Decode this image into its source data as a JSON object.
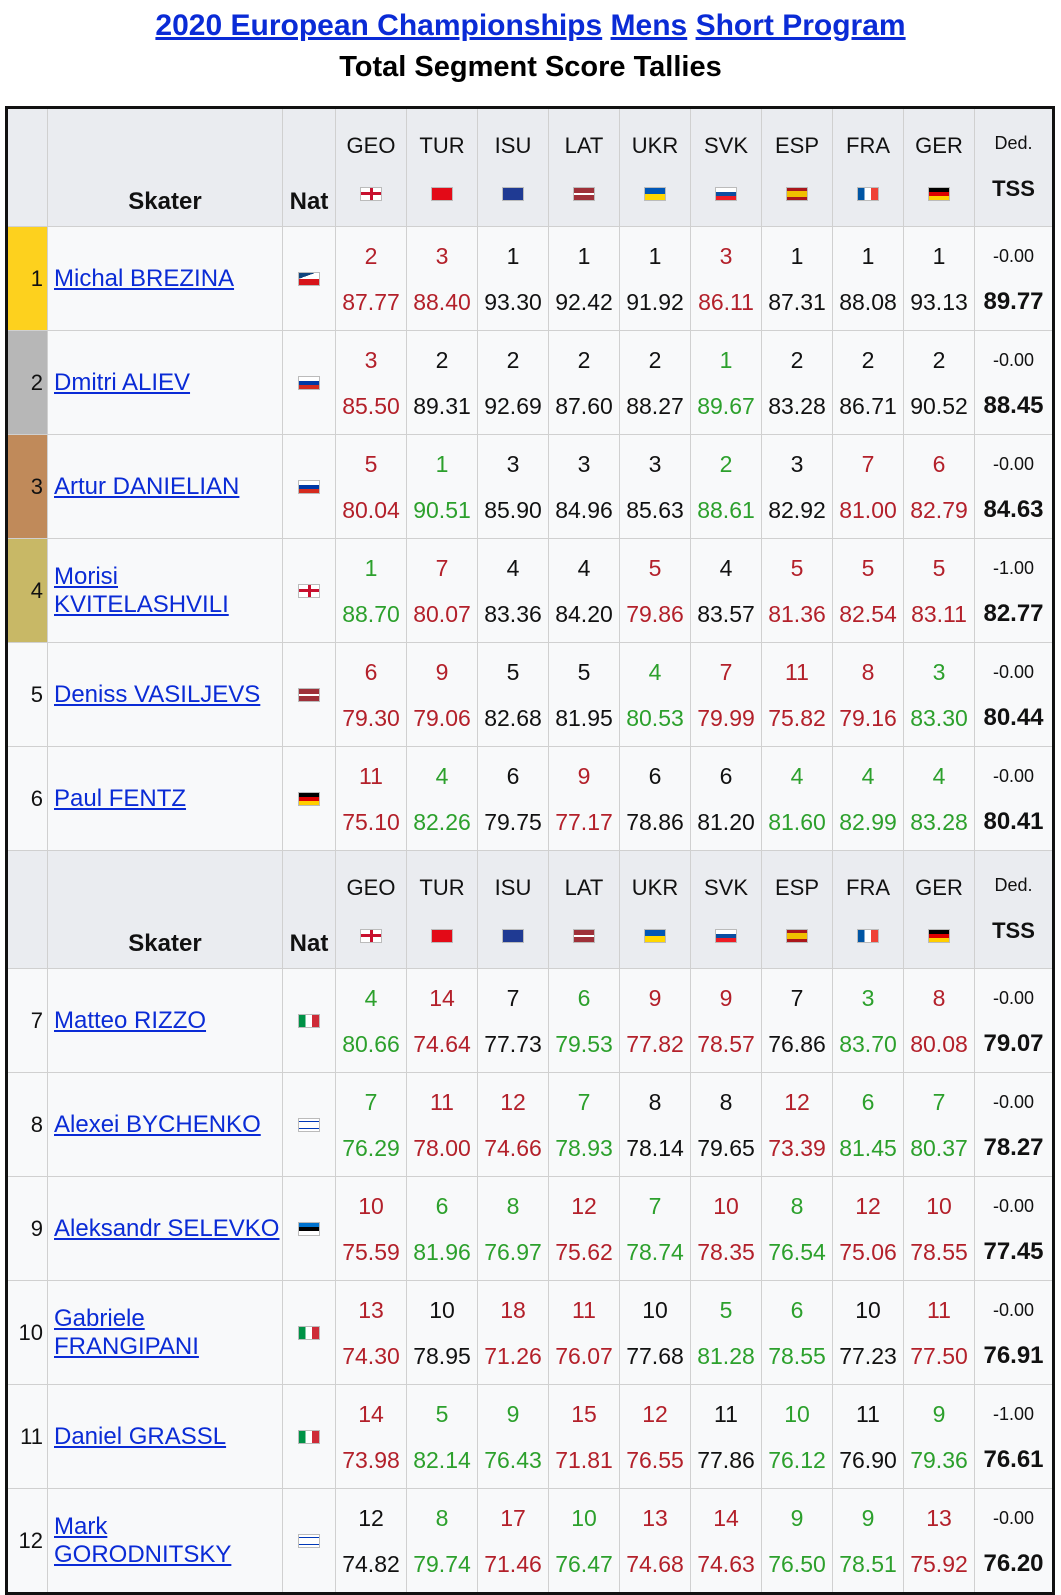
{
  "title": {
    "link1": "2020 European Championships",
    "link2": "Mens",
    "link3": "Short Program"
  },
  "subtitle": "Total Segment Score Tallies",
  "header": {
    "skater": "Skater",
    "nat": "Nat",
    "ded": "Ded.",
    "tss": "TSS",
    "judges": [
      "GEO",
      "TUR",
      "ISU",
      "LAT",
      "UKR",
      "SVK",
      "ESP",
      "FRA",
      "GER"
    ]
  },
  "colors": {
    "gold": "#fdd11e",
    "silver": "#b7b7b7",
    "bronze": "#c08a5a",
    "fourth": "#c8b866",
    "green": "#2ca02c",
    "red": "#b3202a",
    "link": "#0a2bd6"
  },
  "rows": [
    {
      "rank": "1",
      "name": "Michal BREZINA",
      "nat_flag": "CZE",
      "ded": "-0.00",
      "tss": "89.77",
      "cells": [
        [
          "2",
          "87.77",
          "red"
        ],
        [
          "3",
          "88.40",
          "red"
        ],
        [
          "1",
          "93.30",
          "black"
        ],
        [
          "1",
          "92.42",
          "black"
        ],
        [
          "1",
          "91.92",
          "black"
        ],
        [
          "3",
          "86.11",
          "red"
        ],
        [
          "1",
          "87.31",
          "black"
        ],
        [
          "1",
          "88.08",
          "black"
        ],
        [
          "1",
          "93.13",
          "black"
        ]
      ]
    },
    {
      "rank": "2",
      "name": "Dmitri ALIEV",
      "nat_flag": "RUS",
      "ded": "-0.00",
      "tss": "88.45",
      "cells": [
        [
          "3",
          "85.50",
          "red"
        ],
        [
          "2",
          "89.31",
          "black"
        ],
        [
          "2",
          "92.69",
          "black"
        ],
        [
          "2",
          "87.60",
          "black"
        ],
        [
          "2",
          "88.27",
          "black"
        ],
        [
          "1",
          "89.67",
          "green"
        ],
        [
          "2",
          "83.28",
          "black"
        ],
        [
          "2",
          "86.71",
          "black"
        ],
        [
          "2",
          "90.52",
          "black"
        ]
      ]
    },
    {
      "rank": "3",
      "name": "Artur DANIELIAN",
      "nat_flag": "RUS",
      "ded": "-0.00",
      "tss": "84.63",
      "cells": [
        [
          "5",
          "80.04",
          "red"
        ],
        [
          "1",
          "90.51",
          "green"
        ],
        [
          "3",
          "85.90",
          "black"
        ],
        [
          "3",
          "84.96",
          "black"
        ],
        [
          "3",
          "85.63",
          "black"
        ],
        [
          "2",
          "88.61",
          "green"
        ],
        [
          "3",
          "82.92",
          "black"
        ],
        [
          "7",
          "81.00",
          "red"
        ],
        [
          "6",
          "82.79",
          "red"
        ]
      ]
    },
    {
      "rank": "4",
      "name": "Morisi KVITELASHVILI",
      "nat_flag": "GEO",
      "ded": "-1.00",
      "tss": "82.77",
      "cells": [
        [
          "1",
          "88.70",
          "green"
        ],
        [
          "7",
          "80.07",
          "red"
        ],
        [
          "4",
          "83.36",
          "black"
        ],
        [
          "4",
          "84.20",
          "black"
        ],
        [
          "5",
          "79.86",
          "red"
        ],
        [
          "4",
          "83.57",
          "black"
        ],
        [
          "5",
          "81.36",
          "red"
        ],
        [
          "5",
          "82.54",
          "red"
        ],
        [
          "5",
          "83.11",
          "red"
        ]
      ]
    },
    {
      "rank": "5",
      "name": "Deniss VASILJEVS",
      "nat_flag": "LAT",
      "ded": "-0.00",
      "tss": "80.44",
      "cells": [
        [
          "6",
          "79.30",
          "red"
        ],
        [
          "9",
          "79.06",
          "red"
        ],
        [
          "5",
          "82.68",
          "black"
        ],
        [
          "5",
          "81.95",
          "black"
        ],
        [
          "4",
          "80.53",
          "green"
        ],
        [
          "7",
          "79.99",
          "red"
        ],
        [
          "11",
          "75.82",
          "red"
        ],
        [
          "8",
          "79.16",
          "red"
        ],
        [
          "3",
          "83.30",
          "green"
        ]
      ]
    },
    {
      "rank": "6",
      "name": "Paul FENTZ",
      "nat_flag": "GER",
      "ded": "-0.00",
      "tss": "80.41",
      "cells": [
        [
          "11",
          "75.10",
          "red"
        ],
        [
          "4",
          "82.26",
          "green"
        ],
        [
          "6",
          "79.75",
          "black"
        ],
        [
          "9",
          "77.17",
          "red"
        ],
        [
          "6",
          "78.86",
          "black"
        ],
        [
          "6",
          "81.20",
          "black"
        ],
        [
          "4",
          "81.60",
          "green"
        ],
        [
          "4",
          "82.99",
          "green"
        ],
        [
          "4",
          "83.28",
          "green"
        ]
      ]
    },
    {
      "rank": "7",
      "name": "Matteo RIZZO",
      "nat_flag": "ITA",
      "ded": "-0.00",
      "tss": "79.07",
      "cells": [
        [
          "4",
          "80.66",
          "green"
        ],
        [
          "14",
          "74.64",
          "red"
        ],
        [
          "7",
          "77.73",
          "black"
        ],
        [
          "6",
          "79.53",
          "green"
        ],
        [
          "9",
          "77.82",
          "red"
        ],
        [
          "9",
          "78.57",
          "red"
        ],
        [
          "7",
          "76.86",
          "black"
        ],
        [
          "3",
          "83.70",
          "green"
        ],
        [
          "8",
          "80.08",
          "red"
        ]
      ]
    },
    {
      "rank": "8",
      "name": "Alexei BYCHENKO",
      "nat_flag": "ISR",
      "ded": "-0.00",
      "tss": "78.27",
      "cells": [
        [
          "7",
          "76.29",
          "green"
        ],
        [
          "11",
          "78.00",
          "red"
        ],
        [
          "12",
          "74.66",
          "red"
        ],
        [
          "7",
          "78.93",
          "green"
        ],
        [
          "8",
          "78.14",
          "black"
        ],
        [
          "8",
          "79.65",
          "black"
        ],
        [
          "12",
          "73.39",
          "red"
        ],
        [
          "6",
          "81.45",
          "green"
        ],
        [
          "7",
          "80.37",
          "green"
        ]
      ]
    },
    {
      "rank": "9",
      "name": "Aleksandr SELEVKO",
      "nat_flag": "EST",
      "ded": "-0.00",
      "tss": "77.45",
      "cells": [
        [
          "10",
          "75.59",
          "red"
        ],
        [
          "6",
          "81.96",
          "green"
        ],
        [
          "8",
          "76.97",
          "green"
        ],
        [
          "12",
          "75.62",
          "red"
        ],
        [
          "7",
          "78.74",
          "green"
        ],
        [
          "10",
          "78.35",
          "red"
        ],
        [
          "8",
          "76.54",
          "green"
        ],
        [
          "12",
          "75.06",
          "red"
        ],
        [
          "10",
          "78.55",
          "red"
        ]
      ]
    },
    {
      "rank": "10",
      "name": "Gabriele FRANGIPANI",
      "nat_flag": "ITA",
      "ded": "-0.00",
      "tss": "76.91",
      "cells": [
        [
          "13",
          "74.30",
          "red"
        ],
        [
          "10",
          "78.95",
          "black"
        ],
        [
          "18",
          "71.26",
          "red"
        ],
        [
          "11",
          "76.07",
          "red"
        ],
        [
          "10",
          "77.68",
          "black"
        ],
        [
          "5",
          "81.28",
          "green"
        ],
        [
          "6",
          "78.55",
          "green"
        ],
        [
          "10",
          "77.23",
          "black"
        ],
        [
          "11",
          "77.50",
          "red"
        ]
      ]
    },
    {
      "rank": "11",
      "name": "Daniel GRASSL",
      "nat_flag": "ITA",
      "ded": "-1.00",
      "tss": "76.61",
      "cells": [
        [
          "14",
          "73.98",
          "red"
        ],
        [
          "5",
          "82.14",
          "green"
        ],
        [
          "9",
          "76.43",
          "green"
        ],
        [
          "15",
          "71.81",
          "red"
        ],
        [
          "12",
          "76.55",
          "red"
        ],
        [
          "11",
          "77.86",
          "black"
        ],
        [
          "10",
          "76.12",
          "green"
        ],
        [
          "11",
          "76.90",
          "black"
        ],
        [
          "9",
          "79.36",
          "green"
        ]
      ]
    },
    {
      "rank": "12",
      "name": "Mark GORODNITSKY",
      "nat_flag": "ISR",
      "ded": "-0.00",
      "tss": "76.20",
      "cells": [
        [
          "12",
          "74.82",
          "black"
        ],
        [
          "8",
          "79.74",
          "green"
        ],
        [
          "17",
          "71.46",
          "red"
        ],
        [
          "10",
          "76.47",
          "green"
        ],
        [
          "13",
          "74.68",
          "red"
        ],
        [
          "14",
          "74.63",
          "red"
        ],
        [
          "9",
          "76.50",
          "green"
        ],
        [
          "9",
          "78.51",
          "green"
        ],
        [
          "13",
          "75.92",
          "red"
        ]
      ]
    }
  ]
}
